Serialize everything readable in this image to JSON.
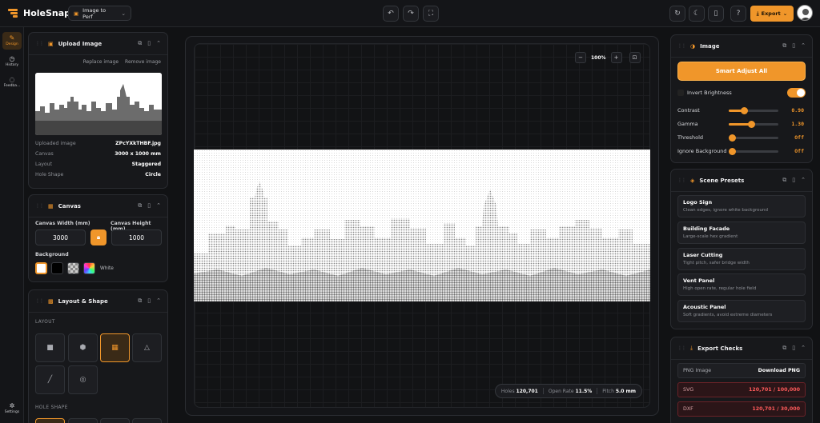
{
  "app": {
    "name": "HoleSnap",
    "tool_label": "Image to Perf",
    "export_label": "Export"
  },
  "rail": [
    {
      "id": "design",
      "label": "Design",
      "icon": "brush-icon",
      "active": true
    },
    {
      "id": "history",
      "label": "History",
      "icon": "clock-icon",
      "active": false
    },
    {
      "id": "feedback",
      "label": "Feedba...",
      "icon": "chat-icon",
      "active": false
    },
    {
      "id": "settings",
      "label": "Settings",
      "icon": "gear-icon",
      "active": false
    }
  ],
  "upload": {
    "title": "Upload Image",
    "replace_label": "Replace image",
    "remove_label": "Remove image",
    "rows": [
      {
        "k": "Uploaded image",
        "v": "ZPcYXkTHBF.jpg"
      },
      {
        "k": "Canvas",
        "v": "3000 x 1000 mm"
      },
      {
        "k": "Layout",
        "v": "Staggered"
      },
      {
        "k": "Hole Shape",
        "v": "Circle"
      }
    ]
  },
  "canvas_panel": {
    "title": "Canvas",
    "width_label": "Canvas Width (mm)",
    "height_label": "Canvas Height (mm)",
    "width_value": "3000",
    "height_value": "1000",
    "background_label": "Background",
    "background_selected": "White",
    "swatches": [
      "#ffffff",
      "#000000",
      "checker",
      "rainbow"
    ]
  },
  "layout_panel": {
    "title": "Layout & Shape",
    "layout_caption": "LAYOUT",
    "hole_shape_caption": "HOLE SHAPE"
  },
  "stage": {
    "zoom": "100%",
    "stats": [
      {
        "k": "Holes",
        "v": "120,701"
      },
      {
        "k": "Open Rate",
        "v": "11.5%"
      },
      {
        "k": "Pitch",
        "v": "5.0 mm"
      }
    ]
  },
  "image_panel": {
    "title": "Image",
    "smart_label": "Smart Adjust All",
    "invert_label": "Invert Brightness",
    "invert_on": true,
    "sliders": [
      {
        "label": "Contrast",
        "value": "0.90",
        "level": 0.3
      },
      {
        "label": "Gamma",
        "value": "1.30",
        "level": 0.45
      },
      {
        "label": "Threshold",
        "value": "Off",
        "level": 0.0
      },
      {
        "label": "Ignore Background",
        "value": "Off",
        "level": 0.0
      }
    ]
  },
  "presets_panel": {
    "title": "Scene Presets",
    "items": [
      {
        "t": "Logo Sign",
        "d": "Clean edges, ignore white background"
      },
      {
        "t": "Building Facade",
        "d": "Large-scale hex gradient"
      },
      {
        "t": "Laser Cutting",
        "d": "Tight pitch, safer bridge width"
      },
      {
        "t": "Vent Panel",
        "d": "High open rate, regular hole field"
      },
      {
        "t": "Acoustic Panel",
        "d": "Soft gradients, avoid extreme diameters"
      }
    ]
  },
  "export_panel": {
    "title": "Export Checks",
    "rows": [
      {
        "k": "PNG Image",
        "v": "Download PNG",
        "state": "ok"
      },
      {
        "k": "SVG",
        "v": "120,701 / 100,000",
        "state": "bad"
      },
      {
        "k": "DXF",
        "v": "120,701 / 30,000",
        "state": "bad"
      }
    ]
  },
  "colors": {
    "accent": "#f0962a",
    "error": "#ff5b5b",
    "bg": "#111214",
    "panel": "#17181b"
  }
}
